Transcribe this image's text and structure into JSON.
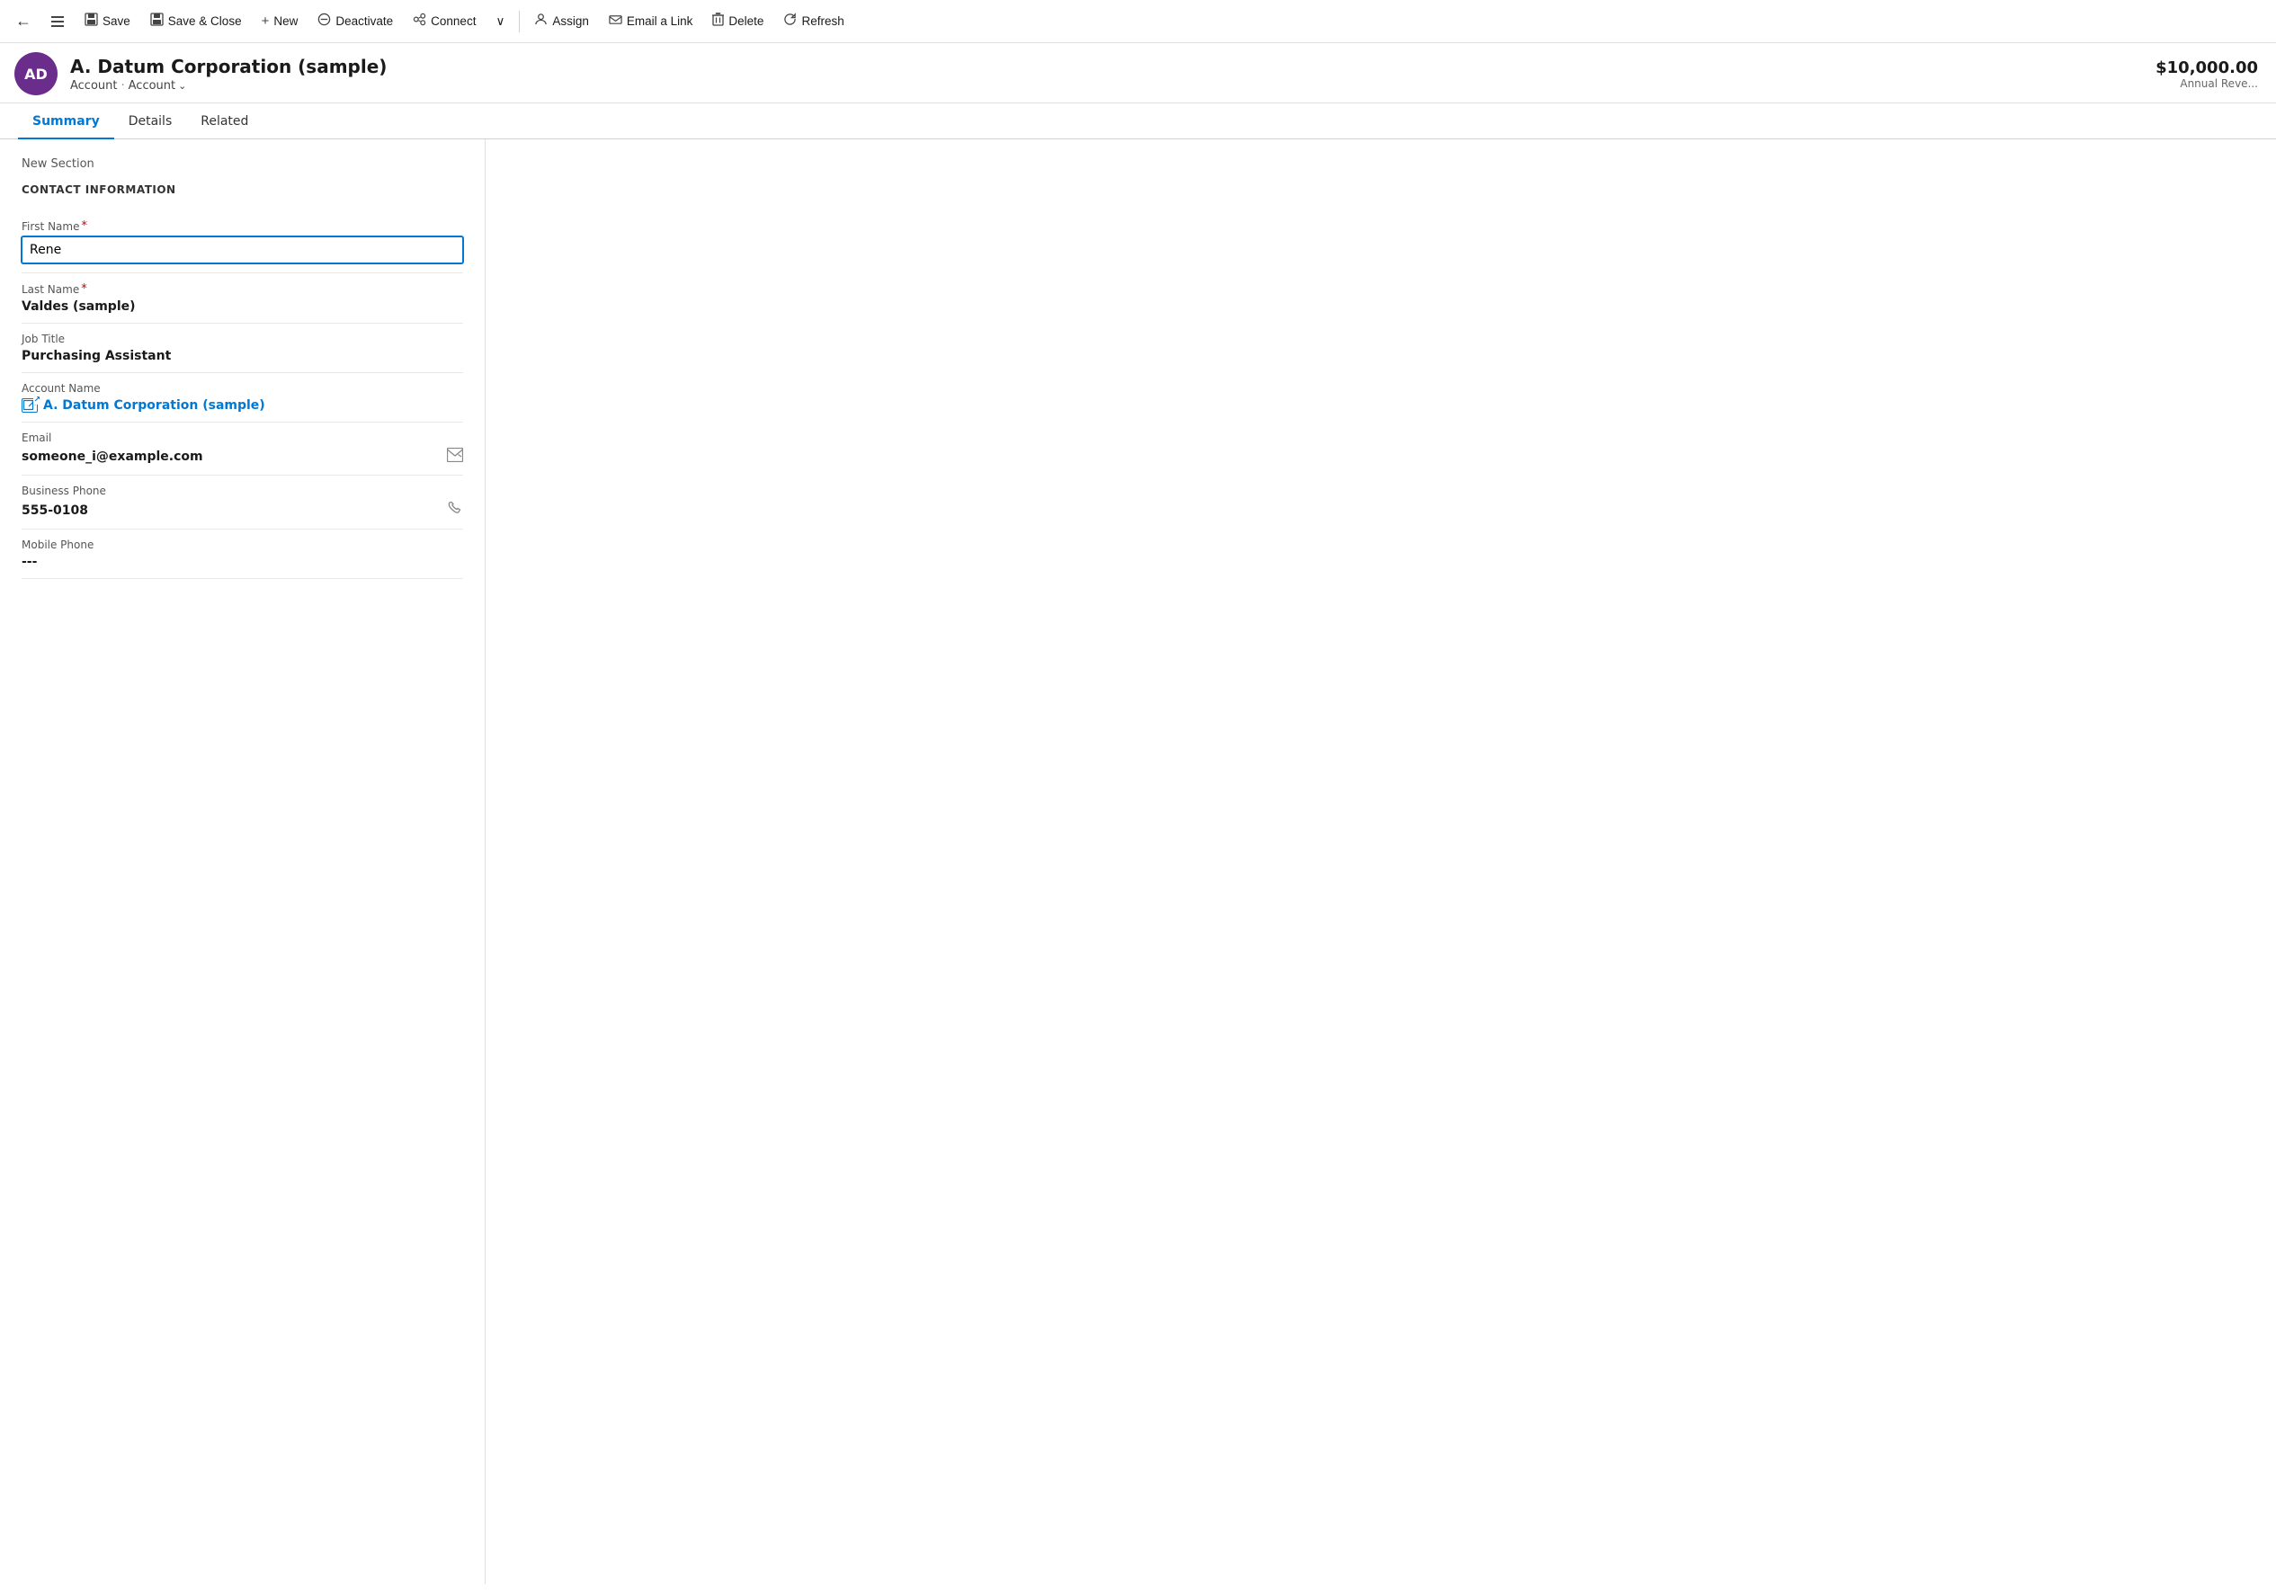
{
  "toolbar": {
    "back_label": "←",
    "nav_icon": "≡",
    "save_label": "Save",
    "save_close_label": "Save & Close",
    "new_label": "New",
    "deactivate_label": "Deactivate",
    "connect_label": "Connect",
    "more_label": "∨",
    "assign_label": "Assign",
    "email_link_label": "Email a Link",
    "delete_label": "Delete",
    "refresh_label": "Refresh"
  },
  "entity": {
    "avatar_text": "AD",
    "name": "A. Datum Corporation (sample)",
    "breadcrumb_1": "Account",
    "breadcrumb_sep": "·",
    "breadcrumb_2": "Account",
    "annual_revenue": "$10,000.00",
    "annual_label": "Annual Reve..."
  },
  "tabs": [
    {
      "label": "Summary",
      "active": true
    },
    {
      "label": "Details",
      "active": false
    },
    {
      "label": "Related",
      "active": false
    }
  ],
  "form": {
    "section_title": "New Section",
    "section_heading": "CONTACT INFORMATION",
    "fields": [
      {
        "label": "First Name",
        "required": true,
        "type": "input",
        "value": "Rene",
        "name": "first-name-field"
      },
      {
        "label": "Last Name",
        "required": true,
        "type": "text",
        "value": "Valdes (sample)",
        "name": "last-name-field"
      },
      {
        "label": "Job Title",
        "required": false,
        "type": "text",
        "value": "Purchasing Assistant",
        "name": "job-title-field"
      },
      {
        "label": "Account Name",
        "required": false,
        "type": "link",
        "value": "A. Datum Corporation (sample)",
        "name": "account-name-field"
      },
      {
        "label": "Email",
        "required": false,
        "type": "text-action",
        "value": "someone_i@example.com",
        "action_icon": "✉",
        "name": "email-field"
      },
      {
        "label": "Business Phone",
        "required": false,
        "type": "text-action",
        "value": "555-0108",
        "action_icon": "📞",
        "name": "business-phone-field"
      },
      {
        "label": "Mobile Phone",
        "required": false,
        "type": "text",
        "value": "---",
        "name": "mobile-phone-field"
      }
    ]
  }
}
